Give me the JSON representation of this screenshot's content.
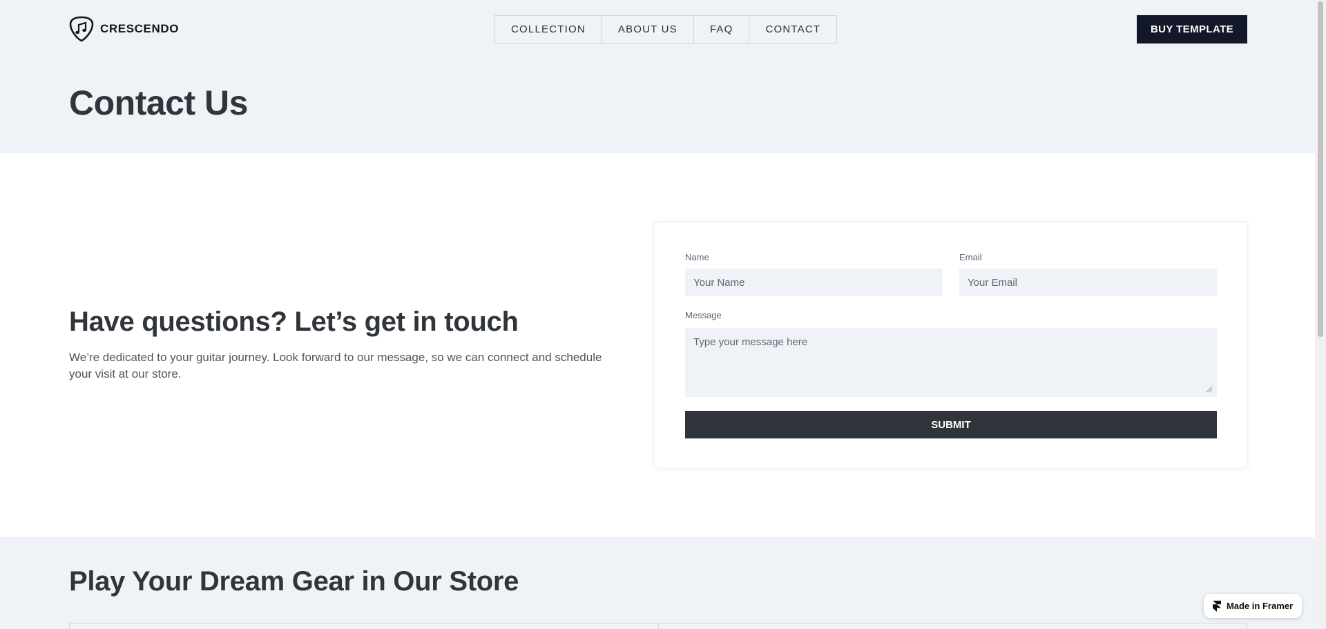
{
  "brand": {
    "name": "CRESCENDO",
    "logo_icon": "guitar-pick-music-note-icon"
  },
  "nav": {
    "items": [
      {
        "label": "COLLECTION"
      },
      {
        "label": "ABOUT US"
      },
      {
        "label": "FAQ"
      },
      {
        "label": "CONTACT"
      }
    ],
    "cta_label": "BUY TEMPLATE"
  },
  "page_title": "Contact Us",
  "intro": {
    "heading": "Have questions? Let’s get in touch",
    "text": "We’re dedicated to your guitar journey. Look forward to our message, so we can connect and schedule your visit at our store."
  },
  "form": {
    "name_label": "Name",
    "name_placeholder": "Your Name",
    "name_value": "",
    "email_label": "Email",
    "email_placeholder": "Your Email",
    "email_value": "",
    "message_label": "Message",
    "message_placeholder": "Type your message here",
    "message_value": "",
    "submit_label": "SUBMIT"
  },
  "store_section": {
    "heading": "Play Your Dream Gear in Our Store"
  },
  "framer_badge": {
    "label": "Made in Framer",
    "icon": "framer-logo-icon"
  },
  "colors": {
    "band_background": "#eff3f7",
    "text_dark": "#2f353b",
    "cta_background": "#12172a",
    "submit_background": "#2f353b"
  }
}
